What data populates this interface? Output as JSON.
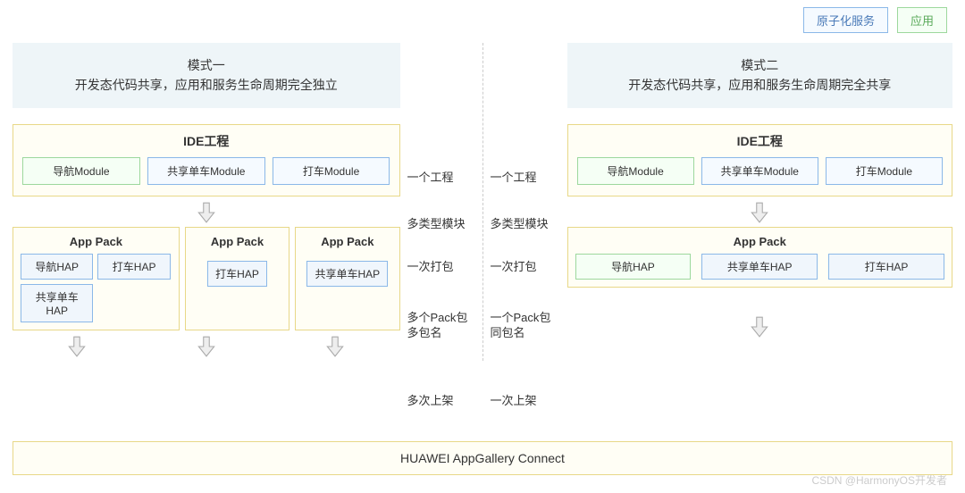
{
  "legend": {
    "atomic": "原子化服务",
    "app": "应用"
  },
  "left": {
    "title": "模式一",
    "subtitle": "开发态代码共享，应用和服务生命周期完全独立",
    "ide_title": "IDE工程",
    "modules": [
      "导航Module",
      "共享单车Module",
      "打车Module"
    ],
    "pack_title": "App Pack",
    "pack1_haps": [
      "导航HAP",
      "打车HAP",
      "共享单车HAP"
    ],
    "pack2_haps": [
      "打车HAP"
    ],
    "pack3_haps": [
      "共享单车HAP"
    ],
    "annotations": {
      "project": "一个工程",
      "modules": "多类型模块",
      "pack": "一次打包",
      "packnames": "多个Pack包\n多包名",
      "shelf": "多次上架"
    }
  },
  "right": {
    "title": "模式二",
    "subtitle": "开发态代码共享，应用和服务生命周期完全共享",
    "ide_title": "IDE工程",
    "modules": [
      "导航Module",
      "共享单车Module",
      "打车Module"
    ],
    "pack_title": "App Pack",
    "pack_haps": [
      "导航HAP",
      "共享单车HAP",
      "打车HAP"
    ],
    "annotations": {
      "project": "一个工程",
      "modules": "多类型模块",
      "pack": "一次打包",
      "packnames": "一个Pack包\n同包名",
      "shelf": "一次上架"
    }
  },
  "bottom": "HUAWEI AppGallery Connect",
  "watermark": "CSDN @HarmonyOS开发者"
}
